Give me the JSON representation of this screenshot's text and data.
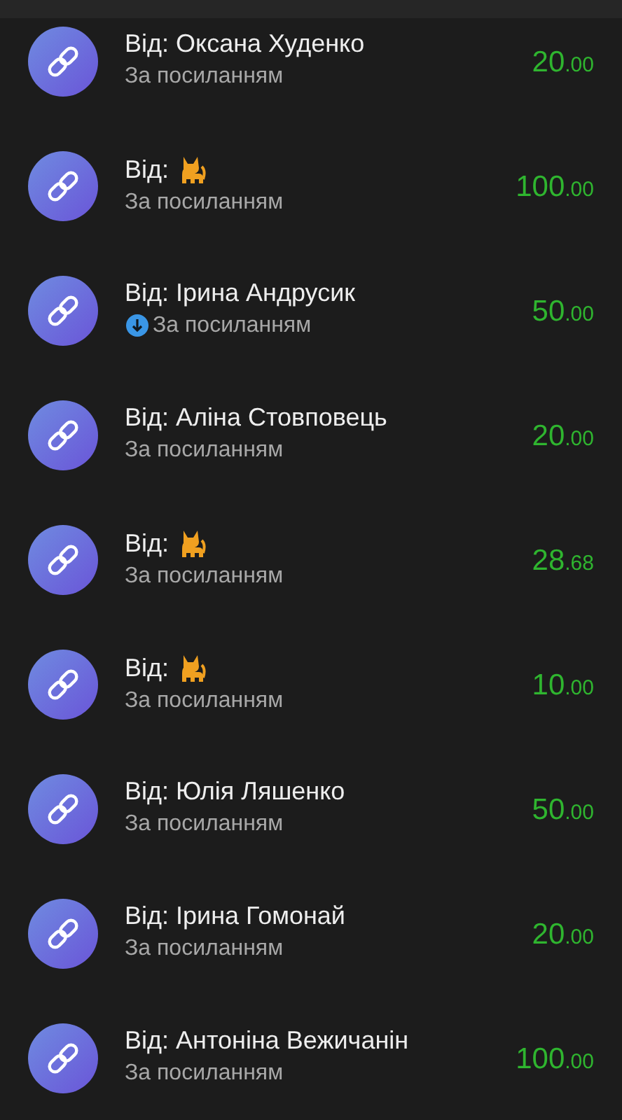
{
  "transactions": [
    {
      "sender": "Від: Оксана Худенко",
      "kind": "name",
      "method": "За посиланням",
      "download_badge": false,
      "amount": "20",
      "cents": ".00"
    },
    {
      "sender": "Від:",
      "kind": "cat",
      "method": "За посиланням",
      "download_badge": false,
      "amount": "100",
      "cents": ".00"
    },
    {
      "sender": "Від: Ірина Андрусик",
      "kind": "name",
      "method": "За посиланням",
      "download_badge": true,
      "amount": "50",
      "cents": ".00"
    },
    {
      "sender": "Від: Аліна Стовповець",
      "kind": "name",
      "method": "За посиланням",
      "download_badge": false,
      "amount": "20",
      "cents": ".00"
    },
    {
      "sender": "Від:",
      "kind": "cat",
      "method": "За посиланням",
      "download_badge": false,
      "amount": "28",
      "cents": ".68"
    },
    {
      "sender": "Від:",
      "kind": "cat",
      "method": "За посиланням",
      "download_badge": false,
      "amount": "10",
      "cents": ".00"
    },
    {
      "sender": "Від: Юлія Ляшенко",
      "kind": "name",
      "method": "За посиланням",
      "download_badge": false,
      "amount": "50",
      "cents": ".00"
    },
    {
      "sender": "Від: Ірина Гомонай",
      "kind": "name",
      "method": "За посиланням",
      "download_badge": false,
      "amount": "20",
      "cents": ".00"
    },
    {
      "sender": "Від: Антоніна Вежичанін",
      "kind": "name",
      "method": "За посиланням",
      "download_badge": false,
      "amount": "100",
      "cents": ".00"
    }
  ]
}
